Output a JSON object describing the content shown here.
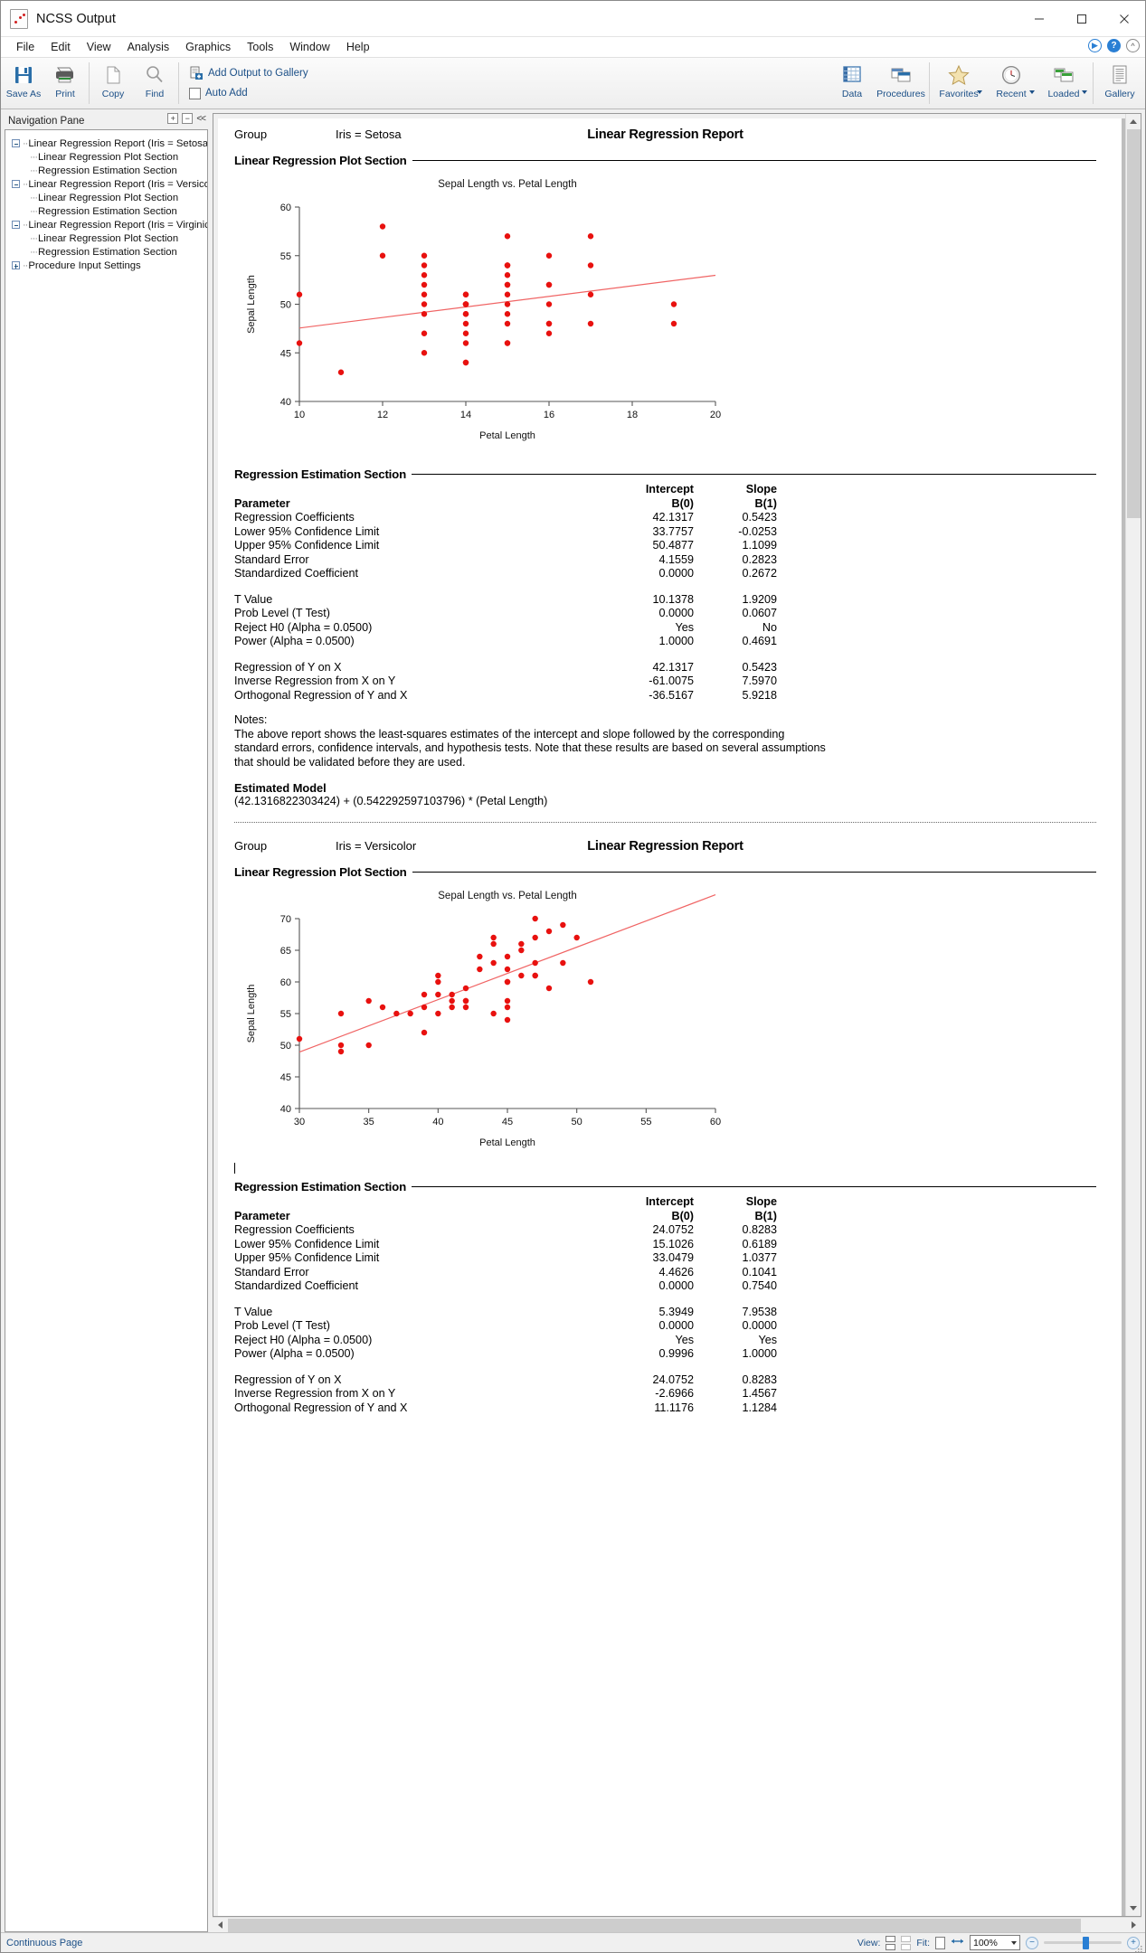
{
  "window": {
    "title": "NCSS Output",
    "icon": "ncss-app-icon",
    "minimize": "minimize",
    "maximize": "maximize",
    "close": "close"
  },
  "menu": {
    "items": [
      "File",
      "Edit",
      "View",
      "Analysis",
      "Graphics",
      "Tools",
      "Window",
      "Help"
    ],
    "right_buttons": [
      "run-icon",
      "help-icon",
      "collapse-ribbon-icon"
    ]
  },
  "ribbon": {
    "buttons": [
      {
        "label": "Save As",
        "icon": "save-icon"
      },
      {
        "label": "Print",
        "icon": "printer-icon"
      },
      {
        "label": "Copy",
        "icon": "copy-icon"
      },
      {
        "label": "Find",
        "icon": "magnifier-icon"
      }
    ],
    "gallery_group": {
      "add_output": "Add Output to Gallery",
      "auto_add": "Auto Add"
    },
    "right_buttons": [
      {
        "label": "Data",
        "icon": "spreadsheet-icon",
        "dropdown": false
      },
      {
        "label": "Procedures",
        "icon": "windows-icon",
        "dropdown": false
      },
      {
        "label": "Favorites",
        "icon": "star-icon",
        "dropdown": true
      },
      {
        "label": "Recent",
        "icon": "clock-icon",
        "dropdown": true
      },
      {
        "label": "Loaded",
        "icon": "windows-green-icon",
        "dropdown": true
      },
      {
        "label": "Gallery",
        "icon": "document-lines-icon",
        "dropdown": false
      }
    ]
  },
  "navigation": {
    "header": "Navigation Pane",
    "header_buttons": [
      "expand-all-icon",
      "collapse-all-icon",
      "hide-pane-icon"
    ],
    "tree": [
      {
        "level": 0,
        "expander": "minus",
        "label": "Linear Regression Report (Iris = Setosa)"
      },
      {
        "level": 1,
        "expander": "none",
        "label": "Linear Regression Plot Section"
      },
      {
        "level": 1,
        "expander": "none",
        "label": "Regression Estimation Section"
      },
      {
        "level": 0,
        "expander": "minus",
        "label": "Linear Regression Report (Iris = Versicolor)"
      },
      {
        "level": 1,
        "expander": "none",
        "label": "Linear Regression Plot Section"
      },
      {
        "level": 1,
        "expander": "none",
        "label": "Regression Estimation Section"
      },
      {
        "level": 0,
        "expander": "minus",
        "label": "Linear Regression Report (Iris = Virginica)"
      },
      {
        "level": 1,
        "expander": "none",
        "label": "Linear Regression Plot Section"
      },
      {
        "level": 1,
        "expander": "none",
        "label": "Regression Estimation Section"
      },
      {
        "level": 0,
        "expander": "plus",
        "label": "Procedure Input Settings"
      }
    ]
  },
  "report": {
    "sections": [
      {
        "title": "Linear Regression Report",
        "group_label": "Group",
        "group_value": "Iris = Setosa",
        "plot_section_head": "Linear Regression Plot Section",
        "estimation_section_head": "Regression Estimation Section",
        "table": {
          "col_head_1_top": "Intercept",
          "col_head_1_bot": "B(0)",
          "col_head_2_top": "Slope",
          "col_head_2_bot": "B(1)",
          "row_head": "Parameter",
          "rows": [
            {
              "label": "Regression Coefficients",
              "b0": "42.1317",
              "b1": "0.5423"
            },
            {
              "label": "Lower 95% Confidence Limit",
              "b0": "33.7757",
              "b1": "-0.0253"
            },
            {
              "label": "Upper 95% Confidence Limit",
              "b0": "50.4877",
              "b1": "1.1099"
            },
            {
              "label": "Standard Error",
              "b0": "4.1559",
              "b1": "0.2823"
            },
            {
              "label": "Standardized Coefficient",
              "b0": "0.0000",
              "b1": "0.2672"
            }
          ],
          "rows2": [
            {
              "label": "T Value",
              "b0": "10.1378",
              "b1": "1.9209"
            },
            {
              "label": "Prob Level (T Test)",
              "b0": "0.0000",
              "b1": "0.0607"
            },
            {
              "label": "Reject H0 (Alpha = 0.0500)",
              "b0": "Yes",
              "b1": "No"
            },
            {
              "label": "Power (Alpha = 0.0500)",
              "b0": "1.0000",
              "b1": "0.4691"
            }
          ],
          "rows3": [
            {
              "label": "Regression of Y on X",
              "b0": "42.1317",
              "b1": "0.5423"
            },
            {
              "label": "Inverse Regression from X on Y",
              "b0": "-61.0075",
              "b1": "7.5970"
            },
            {
              "label": "Orthogonal Regression of Y and X",
              "b0": "-36.5167",
              "b1": "5.9218"
            }
          ]
        },
        "notes_head": "Notes:",
        "notes_body": "The above report shows the least-squares estimates of the intercept and slope followed by the corresponding standard errors, confidence intervals, and hypothesis tests. Note that these results are based on several assumptions that should be validated before they are used.",
        "estimated_model_head": "Estimated Model",
        "estimated_model_body": "(42.1316822303424) + (0.542292597103796) * (Petal Length)"
      },
      {
        "title": "Linear Regression Report",
        "group_label": "Group",
        "group_value": "Iris = Versicolor",
        "plot_section_head": "Linear Regression Plot Section",
        "estimation_section_head": "Regression Estimation Section",
        "table": {
          "col_head_1_top": "Intercept",
          "col_head_1_bot": "B(0)",
          "col_head_2_top": "Slope",
          "col_head_2_bot": "B(1)",
          "row_head": "Parameter",
          "rows": [
            {
              "label": "Regression Coefficients",
              "b0": "24.0752",
              "b1": "0.8283"
            },
            {
              "label": "Lower 95% Confidence Limit",
              "b0": "15.1026",
              "b1": "0.6189"
            },
            {
              "label": "Upper 95% Confidence Limit",
              "b0": "33.0479",
              "b1": "1.0377"
            },
            {
              "label": "Standard Error",
              "b0": "4.4626",
              "b1": "0.1041"
            },
            {
              "label": "Standardized Coefficient",
              "b0": "0.0000",
              "b1": "0.7540"
            }
          ],
          "rows2": [
            {
              "label": "T Value",
              "b0": "5.3949",
              "b1": "7.9538"
            },
            {
              "label": "Prob Level (T Test)",
              "b0": "0.0000",
              "b1": "0.0000"
            },
            {
              "label": "Reject H0 (Alpha = 0.0500)",
              "b0": "Yes",
              "b1": "Yes"
            },
            {
              "label": "Power (Alpha = 0.0500)",
              "b0": "0.9996",
              "b1": "1.0000"
            }
          ],
          "rows3": [
            {
              "label": "Regression of Y on X",
              "b0": "24.0752",
              "b1": "0.8283"
            },
            {
              "label": "Inverse Regression from X on Y",
              "b0": "-2.6966",
              "b1": "1.4567"
            },
            {
              "label": "Orthogonal Regression of Y and X",
              "b0": "11.1176",
              "b1": "1.1284"
            }
          ]
        }
      }
    ]
  },
  "chart_data": [
    {
      "type": "scatter",
      "title": "Sepal Length vs. Petal Length",
      "xlabel": "Petal Length",
      "ylabel": "Sepal Length",
      "xlim": [
        10,
        20
      ],
      "ylim": [
        40,
        60
      ],
      "xticks": [
        10,
        12,
        14,
        16,
        18,
        20
      ],
      "yticks": [
        40,
        45,
        50,
        55,
        60
      ],
      "point_color": "#e8110f",
      "line_color": "#f06464",
      "fit_line": {
        "intercept": 42.1317,
        "slope": 0.5423
      },
      "points": [
        [
          14,
          51
        ],
        [
          14,
          49
        ],
        [
          13,
          47
        ],
        [
          15,
          46
        ],
        [
          14,
          50
        ],
        [
          17,
          54
        ],
        [
          14,
          46
        ],
        [
          15,
          50
        ],
        [
          14,
          44
        ],
        [
          15,
          49
        ],
        [
          15,
          54
        ],
        [
          16,
          48
        ],
        [
          14,
          48
        ],
        [
          11,
          43
        ],
        [
          12,
          58
        ],
        [
          15,
          57
        ],
        [
          13,
          54
        ],
        [
          14,
          51
        ],
        [
          17,
          57
        ],
        [
          15,
          54
        ],
        [
          17,
          51
        ],
        [
          15,
          46
        ],
        [
          10,
          51
        ],
        [
          17,
          48
        ],
        [
          19,
          50
        ],
        [
          16,
          50
        ],
        [
          14,
          50
        ],
        [
          16,
          52
        ],
        [
          15,
          52
        ],
        [
          16,
          47
        ],
        [
          15,
          48
        ],
        [
          15,
          54
        ],
        [
          15,
          52
        ],
        [
          16,
          55
        ],
        [
          13,
          49
        ],
        [
          14,
          50
        ],
        [
          12,
          55
        ],
        [
          13,
          55
        ],
        [
          14,
          49
        ],
        [
          15,
          51
        ],
        [
          13,
          50
        ],
        [
          13,
          45
        ],
        [
          13,
          51
        ],
        [
          16,
          48
        ],
        [
          19,
          48
        ],
        [
          14,
          50
        ],
        [
          16,
          52
        ],
        [
          13,
          52
        ],
        [
          15,
          53
        ],
        [
          14,
          44
        ],
        [
          10,
          46
        ],
        [
          13,
          53
        ],
        [
          14,
          47
        ]
      ]
    },
    {
      "type": "scatter",
      "title": "Sepal Length vs. Petal Length",
      "xlabel": "Petal Length",
      "ylabel": "Sepal Length",
      "xlim": [
        30,
        60
      ],
      "ylim": [
        40,
        70
      ],
      "xticks": [
        30,
        35,
        40,
        45,
        50,
        55,
        60
      ],
      "yticks": [
        40,
        45,
        50,
        55,
        60,
        65,
        70
      ],
      "point_color": "#e8110f",
      "line_color": "#f06464",
      "fit_line": {
        "intercept": 24.0752,
        "slope": 0.8283
      },
      "points": [
        [
          47,
          70
        ],
        [
          45,
          64
        ],
        [
          49,
          69
        ],
        [
          33,
          55
        ],
        [
          46,
          65
        ],
        [
          45,
          57
        ],
        [
          47,
          63
        ],
        [
          33,
          49
        ],
        [
          46,
          66
        ],
        [
          39,
          52
        ],
        [
          35,
          50
        ],
        [
          42,
          59
        ],
        [
          40,
          60
        ],
        [
          47,
          61
        ],
        [
          36,
          56
        ],
        [
          44,
          67
        ],
        [
          45,
          56
        ],
        [
          41,
          58
        ],
        [
          45,
          62
        ],
        [
          39,
          56
        ],
        [
          48,
          59
        ],
        [
          40,
          61
        ],
        [
          49,
          63
        ],
        [
          47,
          61
        ],
        [
          43,
          64
        ],
        [
          44,
          66
        ],
        [
          48,
          68
        ],
        [
          50,
          67
        ],
        [
          45,
          60
        ],
        [
          35,
          57
        ],
        [
          38,
          55
        ],
        [
          37,
          55
        ],
        [
          39,
          58
        ],
        [
          51,
          60
        ],
        [
          45,
          54
        ],
        [
          45,
          60
        ],
        [
          47,
          67
        ],
        [
          44,
          63
        ],
        [
          41,
          56
        ],
        [
          40,
          55
        ],
        [
          44,
          55
        ],
        [
          46,
          61
        ],
        [
          40,
          58
        ],
        [
          33,
          50
        ],
        [
          42,
          56
        ],
        [
          42,
          57
        ],
        [
          42,
          57
        ],
        [
          43,
          62
        ],
        [
          30,
          51
        ],
        [
          41,
          57
        ]
      ]
    }
  ],
  "statusbar": {
    "mode": "Continuous Page",
    "view_label": "View:",
    "fit_label": "Fit:",
    "zoom_value": "100%",
    "view_icons": [
      "single-page-icon",
      "two-page-icon"
    ],
    "fit_icons": [
      "fit-page-icon",
      "fit-width-icon"
    ],
    "zoom_out": "−",
    "zoom_in": "+"
  }
}
